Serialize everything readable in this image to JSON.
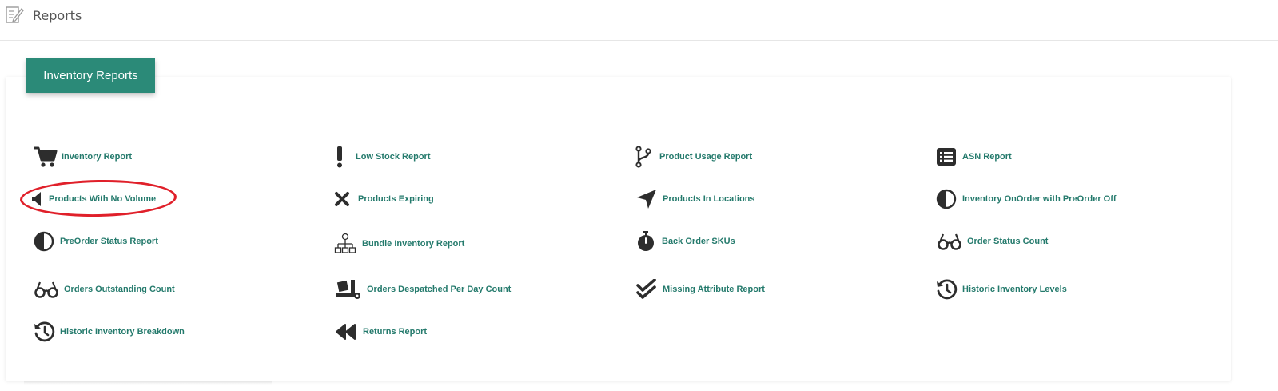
{
  "header": {
    "title": "Reports",
    "icon": "edit-document-icon"
  },
  "card": {
    "tab_label": "Inventory Reports",
    "accent_color": "#2b8a78",
    "link_color": "#247a6c"
  },
  "reports": [
    {
      "label": "Inventory Report",
      "icon": "cart-icon"
    },
    {
      "label": "Low Stock Report",
      "icon": "exclamation-icon"
    },
    {
      "label": "Product Usage Report",
      "icon": "branch-icon"
    },
    {
      "label": "ASN Report",
      "icon": "list-icon"
    },
    {
      "label": "Products With No Volume",
      "icon": "volume-off-icon"
    },
    {
      "label": "Products Expiring",
      "icon": "close-icon"
    },
    {
      "label": "Products In Locations",
      "icon": "location-arrow-icon"
    },
    {
      "label": "Inventory OnOrder with PreOrder Off",
      "icon": "half-circle-icon"
    },
    {
      "label": "PreOrder Status Report",
      "icon": "half-circle-icon"
    },
    {
      "label": "Bundle Inventory Report",
      "icon": "sitemap-icon"
    },
    {
      "label": "Back Order SKUs",
      "icon": "stopwatch-icon"
    },
    {
      "label": "Order Status Count",
      "icon": "glasses-icon"
    },
    {
      "label": "Orders Outstanding Count",
      "icon": "glasses-icon"
    },
    {
      "label": "Orders Despatched Per Day Count",
      "icon": "truck-loading-icon"
    },
    {
      "label": "Missing Attribute Report",
      "icon": "double-check-icon"
    },
    {
      "label": "Historic Inventory Levels",
      "icon": "history-icon"
    },
    {
      "label": "Historic Inventory Breakdown",
      "icon": "history-icon"
    },
    {
      "label": "Returns Report",
      "icon": "backward-icon"
    }
  ],
  "annotation": {
    "color": "#e0202a"
  }
}
